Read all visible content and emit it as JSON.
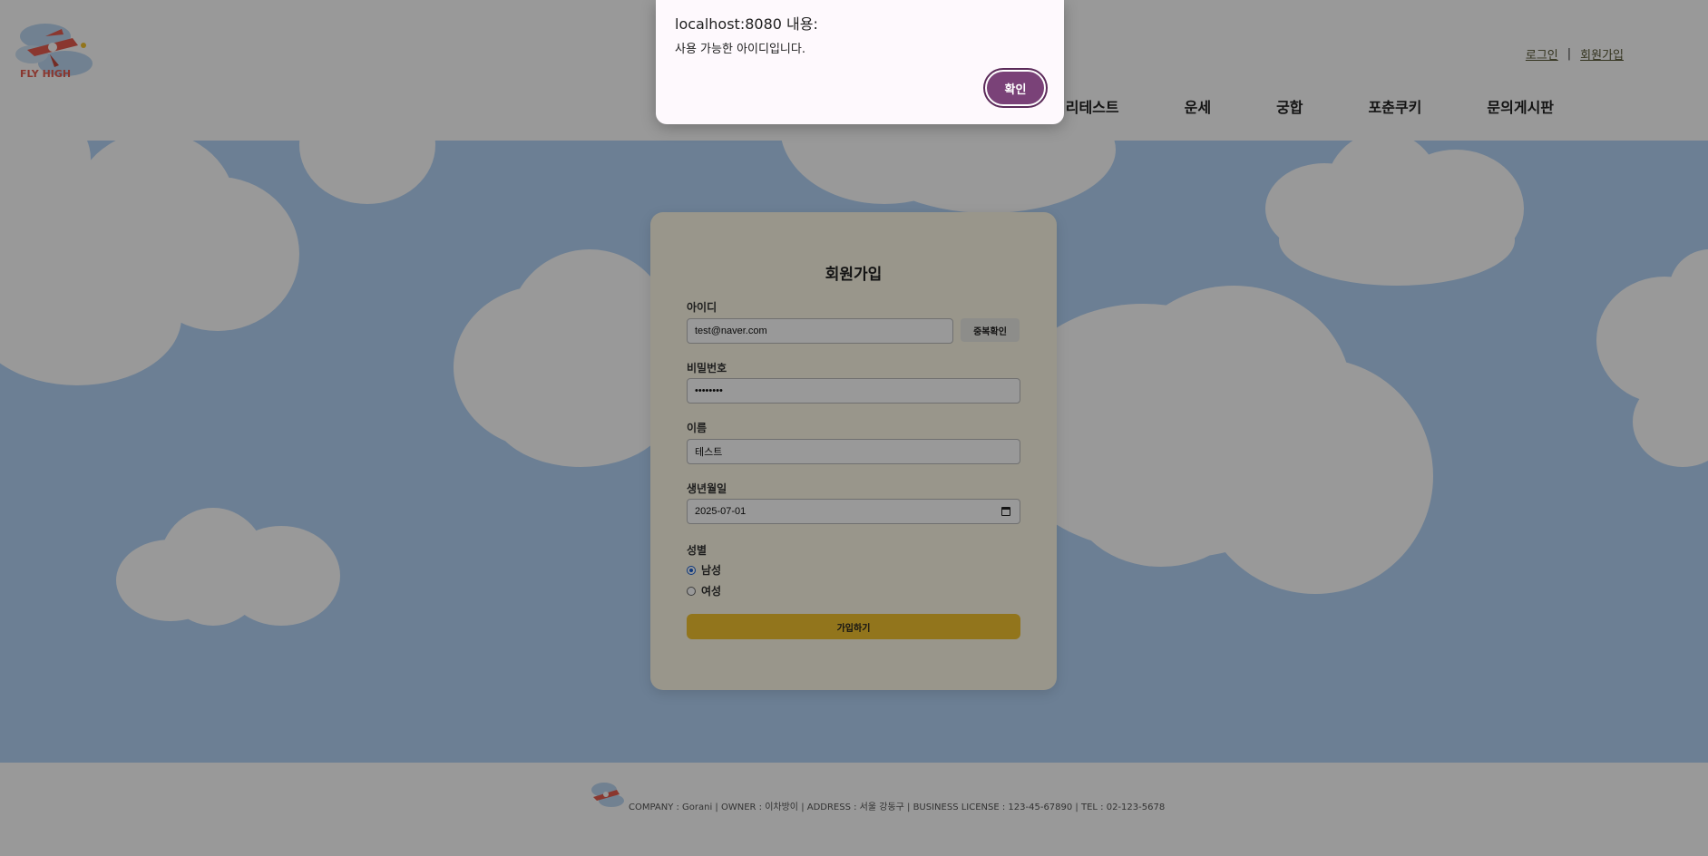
{
  "header": {
    "logo_text": "FLY HIGH",
    "auth": {
      "login": "로그인",
      "separator": "|",
      "signup": "회원가입"
    },
    "nav": [
      "심리테스트",
      "운세",
      "궁합",
      "포춘쿠키",
      "문의게시판"
    ]
  },
  "signup_form": {
    "title": "회원가입",
    "id_label": "아이디",
    "id_value": "test@naver.com",
    "dup_check_button": "중복확인",
    "password_label": "비밀번호",
    "password_value": "••••••••",
    "name_label": "이름",
    "name_value": "테스트",
    "birth_label": "생년월일",
    "birth_value": "2025-07-01",
    "gender_label": "성별",
    "gender_options": [
      {
        "label": "남성",
        "checked": true
      },
      {
        "label": "여성",
        "checked": false
      }
    ],
    "submit_button": "가입하기"
  },
  "footer": {
    "info": "COMPANY : Gorani | OWNER : 이차방이 | ADDRESS : 서울 강동구 | BUSINESS LICENSE : 123-45-67890 | TEL : 02-123-5678"
  },
  "dialog": {
    "title": "localhost:8080 내용:",
    "message": "사용 가능한 아이디입니다.",
    "ok_button": "확인"
  },
  "colors": {
    "sky": "#b4d4f7",
    "card": "#fffbe8",
    "submit": "#f4c430",
    "dialog_button": "#7a4278"
  }
}
